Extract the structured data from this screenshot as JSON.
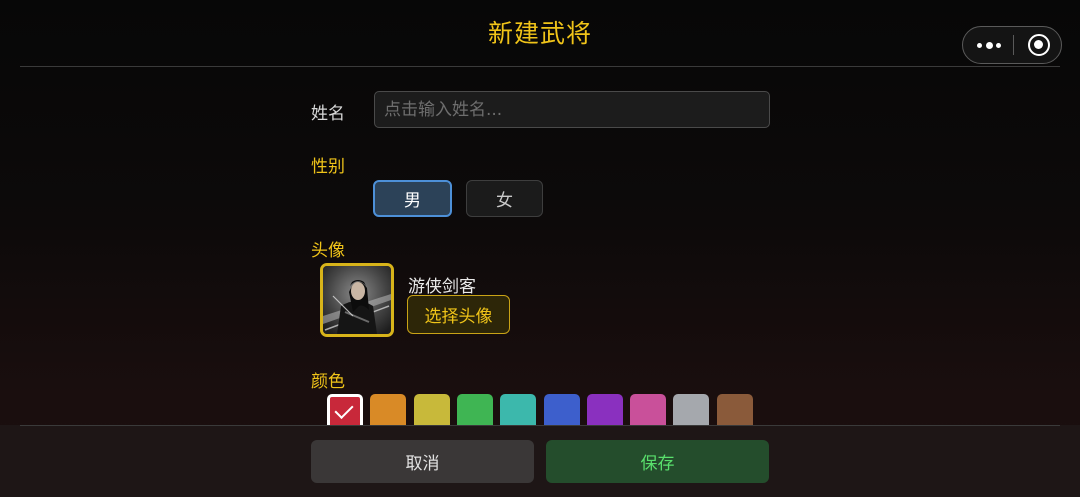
{
  "header": {
    "title": "新建武将",
    "capsule": {
      "more_icon": "more-dots-icon",
      "close_icon": "target-circle-icon"
    }
  },
  "form": {
    "name": {
      "label": "姓名",
      "value": "",
      "placeholder": "点击输入姓名..."
    },
    "gender": {
      "label": "性别",
      "options": [
        "男",
        "女"
      ],
      "selected": "男"
    },
    "avatar": {
      "label": "头像",
      "name": "游侠剑客",
      "choose_label": "选择头像",
      "image_icon": "swordsman-portrait-icon"
    },
    "color": {
      "label": "颜色",
      "options": [
        "#c8283a",
        "#d98a26",
        "#c8b93a",
        "#3fb553",
        "#3cb8ac",
        "#3d5fcc",
        "#8a30bf",
        "#c9509a",
        "#a5a8ad",
        "#8a5a3a"
      ],
      "selected_index": 0
    }
  },
  "footer": {
    "cancel_label": "取消",
    "save_label": "保存"
  },
  "colors": {
    "accent_gold": "#f0c419",
    "selected_blue": "#4d90d8",
    "save_green": "#59e06c"
  }
}
